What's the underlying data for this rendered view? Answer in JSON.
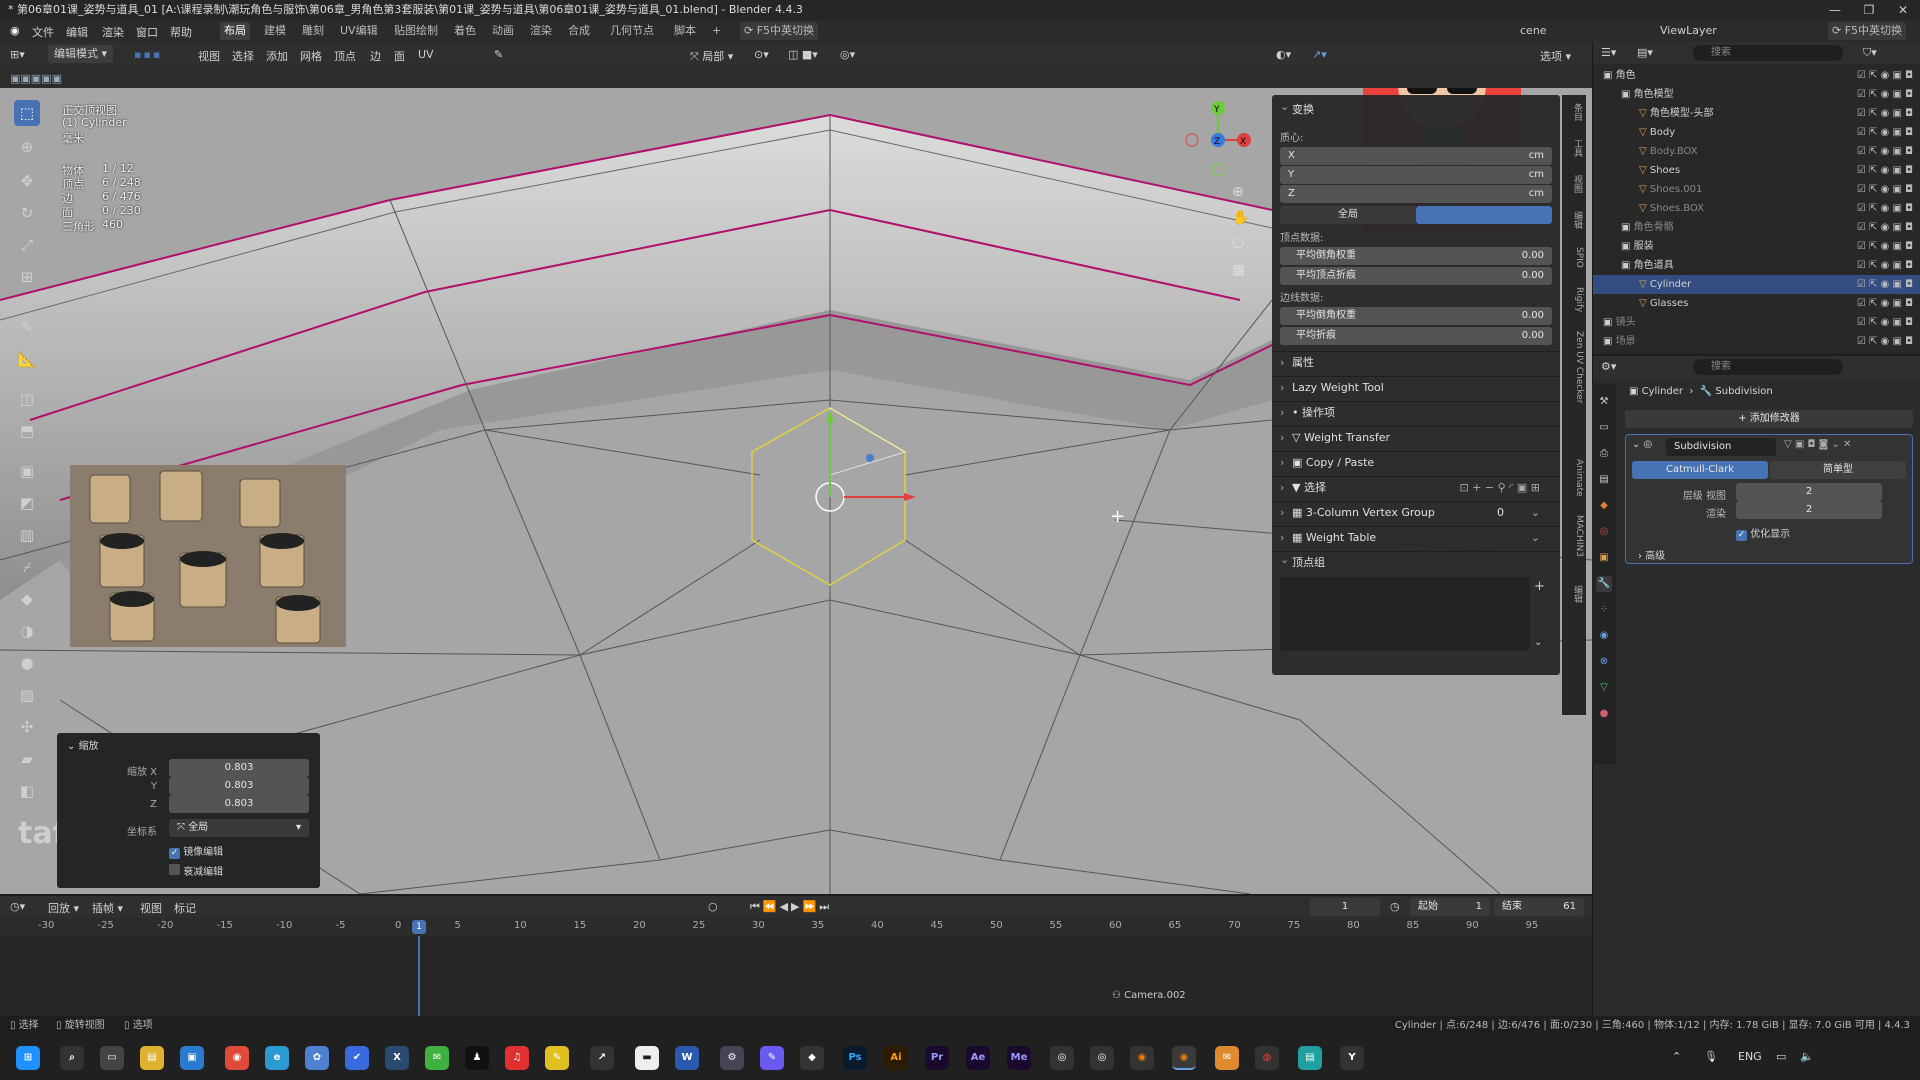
{
  "title": "* 第06章01课_姿势与道具_01 [A:\\课程录制\\潮玩角色与服饰\\第06章_男角色第3套服装\\第01课_姿势与道具\\第06章01课_姿势与道具_01.blend] - Blender 4.4.3",
  "menu": [
    "文件",
    "编辑",
    "渲染",
    "窗口",
    "帮助"
  ],
  "workspaces": [
    "布局",
    "建模",
    "雕刻",
    "UV编辑",
    "贴图绘制",
    "着色",
    "动画",
    "渲染",
    "合成",
    "几何节点",
    "脚本"
  ],
  "ime_label": "F5中英切换",
  "scene_label": "cene",
  "viewlayer_label": "ViewLayer",
  "header": {
    "mode": "编辑模式",
    "menus": [
      "视图",
      "选择",
      "添加",
      "网格",
      "顶点",
      "边",
      "面",
      "UV"
    ],
    "transform_orient": "局部",
    "options": "选项"
  },
  "overlay": {
    "view_name": "正交顶视图",
    "object_name": "(1) Cylinder",
    "unit": "毫米",
    "stats": [
      {
        "k": "物体",
        "v": "1 / 12"
      },
      {
        "k": "顶点",
        "v": "6 / 248"
      },
      {
        "k": "边",
        "v": "6 / 476"
      },
      {
        "k": "面",
        "v": "0 / 230"
      },
      {
        "k": "三角形",
        "v": "460"
      }
    ]
  },
  "npanel": {
    "transform_title": "变换",
    "median_label": "质心:",
    "axes": [
      "X",
      "Y",
      "Z"
    ],
    "unit": "cm",
    "global_btn": "全局",
    "vertex_data": "顶点数据:",
    "vrows": [
      {
        "label": "平均倒角权重",
        "value": "0.00"
      },
      {
        "label": "平均顶点折痕",
        "value": "0.00"
      }
    ],
    "edge_data": "边线数据:",
    "erows": [
      {
        "label": "平均倒角权重",
        "value": "0.00"
      },
      {
        "label": "平均折痕",
        "value": "0.00"
      }
    ],
    "sections": [
      "属性",
      "Lazy Weight Tool",
      "操作项",
      "Weight Transfer",
      "Copy / Paste",
      "选择",
      "3-Column Vertex Group",
      "Weight Table",
      "顶点组"
    ],
    "vg_count": "0"
  },
  "vtabs": [
    "条目",
    "工具",
    "视图",
    "编辑",
    "SPIO",
    "Rigify",
    "Zen UV Checker",
    "Animate",
    "MACHIN3",
    "编辑"
  ],
  "scale_panel": {
    "title": "缩放",
    "rows": [
      {
        "label": "缩放 X",
        "value": "0.803"
      },
      {
        "label": "Y",
        "value": "0.803"
      },
      {
        "label": "Z",
        "value": "0.803"
      }
    ],
    "coord_label": "坐标系",
    "coord_value": "全局",
    "mirror": "镜像编辑",
    "falloff": "衰减编辑"
  },
  "outliner": {
    "search": "搜索",
    "rows": [
      {
        "name": "角色",
        "lvl": 0,
        "icon": "collection"
      },
      {
        "name": "角色模型",
        "lvl": 1,
        "icon": "collection"
      },
      {
        "name": "角色模型-头部",
        "lvl": 2,
        "icon": "mesh"
      },
      {
        "name": "Body",
        "lvl": 2,
        "icon": "mesh"
      },
      {
        "name": "Body.BOX",
        "lvl": 2,
        "icon": "mesh",
        "dim": true
      },
      {
        "name": "Shoes",
        "lvl": 2,
        "icon": "mesh"
      },
      {
        "name": "Shoes.001",
        "lvl": 2,
        "icon": "mesh",
        "dim": true
      },
      {
        "name": "Shoes.BOX",
        "lvl": 2,
        "icon": "mesh",
        "dim": true
      },
      {
        "name": "角色骨骼",
        "lvl": 1,
        "icon": "collection",
        "dim": true
      },
      {
        "name": "服装",
        "lvl": 1,
        "icon": "collection"
      },
      {
        "name": "角色道具",
        "lvl": 1,
        "icon": "collection"
      },
      {
        "name": "Cylinder",
        "lvl": 2,
        "icon": "mesh",
        "sel": true
      },
      {
        "name": "Glasses",
        "lvl": 2,
        "icon": "mesh"
      },
      {
        "name": "镜头",
        "lvl": 0,
        "icon": "collection",
        "dim": true
      },
      {
        "name": "场景",
        "lvl": 0,
        "icon": "collection",
        "dim": true
      }
    ]
  },
  "props": {
    "search": "搜索",
    "breadcrumb_obj": "Cylinder",
    "breadcrumb_mod": "Subdivision",
    "add_modifier": "添加修改器",
    "mod_name": "Subdivision",
    "catmull": "Catmull-Clark",
    "simple": "简单型",
    "levels_view_label": "层级 视图",
    "levels_view": "2",
    "render_label": "渲染",
    "render": "2",
    "optimal": "优化显示",
    "advanced": "高级"
  },
  "timeline": {
    "menus": [
      "回放",
      "插帧",
      "视图",
      "标记"
    ],
    "current_frame": "1",
    "start_label": "起始",
    "start": "1",
    "end_label": "结束",
    "end": "61",
    "cursor": "1",
    "camera_marker": "Camera.002",
    "ticks": [
      "-30",
      "-25",
      "-20",
      "-15",
      "-10",
      "-5",
      "0",
      "5",
      "10",
      "15",
      "20",
      "25",
      "30",
      "35",
      "40",
      "45",
      "50",
      "55",
      "60",
      "65",
      "70",
      "75",
      "80",
      "85",
      "90",
      "95"
    ]
  },
  "statusbar": {
    "left": [
      "选择",
      "旋转视图",
      "选项"
    ],
    "right": "Cylinder | 点:6/248 | 边:6/476 | 面:0/230 | 三角:460 | 物体:1/12 | 内存: 1.78 GiB | 显存: 7.0 GiB 可用 | 4.4.3"
  },
  "taskbar": {
    "lang": "ENG",
    "apps": [
      "Ps",
      "Ai",
      "Pr",
      "Ae",
      "Me"
    ]
  },
  "watermark": "tafe.cc",
  "colors": {
    "accent": "#4772b3",
    "edge_seam": "#b0106a",
    "selected_verts": "#e0d040",
    "viewport": "#9d9d9d"
  }
}
